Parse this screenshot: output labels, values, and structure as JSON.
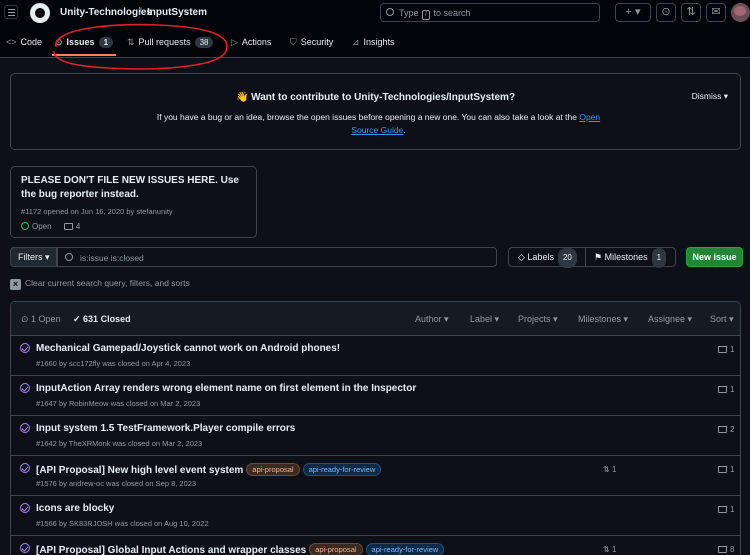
{
  "header": {
    "owner": "Unity-Technologies",
    "separator": "/",
    "repo": "InputSystem",
    "search_placeholder_prefix": "Type",
    "search_key": "/",
    "search_placeholder_suffix": "to search",
    "plus_label": "+ ▾",
    "avatar_label": "cat"
  },
  "tabs": [
    {
      "label": "Code",
      "icon": "code-icon",
      "glyph": "<>"
    },
    {
      "label": "Issues",
      "icon": "issue-icon",
      "glyph": "⊙",
      "count": "1"
    },
    {
      "label": "Pull requests",
      "icon": "pull-request-icon",
      "glyph": "⇅",
      "count": "38"
    },
    {
      "label": "Actions",
      "icon": "play-icon",
      "glyph": "▷"
    },
    {
      "label": "Security",
      "icon": "shield-icon",
      "glyph": "⛉"
    },
    {
      "label": "Insights",
      "icon": "graph-icon",
      "glyph": "⊿"
    }
  ],
  "banner": {
    "emoji": "👋",
    "title": "Want to contribute to Unity-Technologies/InputSystem?",
    "text": "If you have a bug or an idea, browse the open issues before opening a new one. You can also take a look at the ",
    "link": "Open Source Guide",
    "text_end": ".",
    "dismiss": "Dismiss ▾"
  },
  "pinned": {
    "title": "PLEASE DON'T FILE NEW ISSUES HERE. Use the bug reporter instead.",
    "meta": "#1172 opened on Jun 16, 2020 by stefanunity",
    "state": "Open",
    "comments": "4"
  },
  "toolbar": {
    "filters": "Filters ▾",
    "query": "is:issue is:closed",
    "labels": "Labels",
    "labels_count": "20",
    "milestones": "Milestones",
    "milestones_count": "1",
    "new_issue": "New issue",
    "clear": "Clear current search query, filters, and sorts"
  },
  "list_header": {
    "open": "1 Open",
    "closed": "631 Closed",
    "filters": [
      "Author ▾",
      "Label ▾",
      "Projects ▾",
      "Milestones ▾",
      "Assignee ▾",
      "Sort ▾"
    ]
  },
  "issues": [
    {
      "title": "Mechanical Gamepad/Joystick cannot work on Android phones!",
      "meta": "#1660 by scc172fly was closed on Apr 4, 2023",
      "labels": [],
      "prs": "",
      "comments": "1"
    },
    {
      "title": "InputAction Array renders wrong element name on first element in the Inspector",
      "meta": "#1647 by RobinMeow was closed on Mar 2, 2023",
      "labels": [],
      "prs": "",
      "comments": "1"
    },
    {
      "title": "Input system 1.5 TestFramework.Player compile errors",
      "meta": "#1642 by TheXRMonk was closed on Mar 2, 2023",
      "labels": [],
      "prs": "",
      "comments": "2"
    },
    {
      "title": "[API Proposal] New high level event system",
      "meta": "#1576 by andrew-oc was closed on Sep 8, 2023",
      "labels": [
        "api-proposal",
        "api-ready-for-review"
      ],
      "prs": "1",
      "comments": "1"
    },
    {
      "title": "Icons are blocky",
      "meta": "#1566 by SK83RJOSH was closed on Aug 10, 2022",
      "labels": [],
      "prs": "",
      "comments": "1"
    },
    {
      "title": "[API Proposal] Global Input Actions and wrapper classes",
      "meta": "",
      "labels": [
        "api-proposal",
        "api-ready-for-review"
      ],
      "prs": "1",
      "comments": "8"
    }
  ],
  "colors": {
    "accent": "#f78166",
    "closed": "#ab7df8",
    "open": "#3fb950",
    "primary": "#238636",
    "link": "#4493f8"
  }
}
